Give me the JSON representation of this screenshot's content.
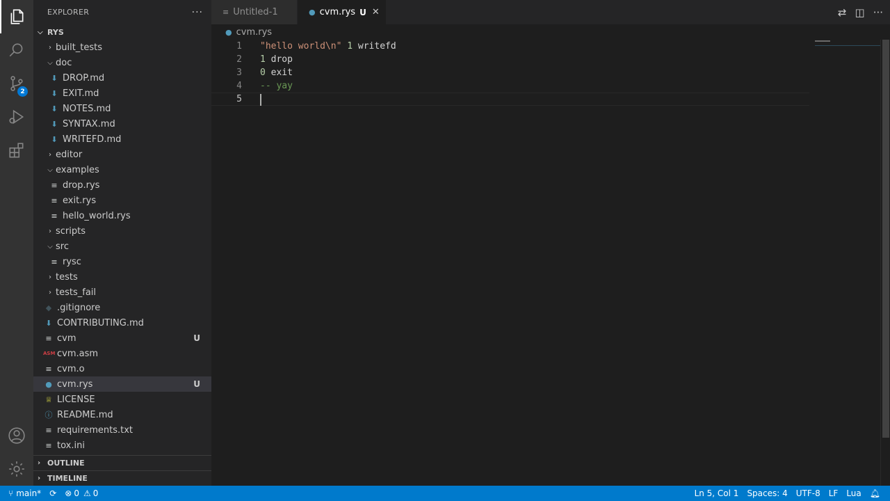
{
  "sidebar": {
    "title": "EXPLORER",
    "more": "···",
    "root": "RYS",
    "items": [
      {
        "label": "built_tests",
        "kind": "folder",
        "open": false,
        "depth": 1
      },
      {
        "label": "doc",
        "kind": "folder",
        "open": true,
        "depth": 1
      },
      {
        "label": "DROP.md",
        "kind": "md",
        "depth": 2
      },
      {
        "label": "EXIT.md",
        "kind": "md",
        "depth": 2
      },
      {
        "label": "NOTES.md",
        "kind": "md",
        "depth": 2
      },
      {
        "label": "SYNTAX.md",
        "kind": "md",
        "depth": 2
      },
      {
        "label": "WRITEFD.md",
        "kind": "md",
        "depth": 2
      },
      {
        "label": "editor",
        "kind": "folder",
        "open": false,
        "depth": 1
      },
      {
        "label": "examples",
        "kind": "folder",
        "open": true,
        "depth": 1
      },
      {
        "label": "drop.rys",
        "kind": "txt",
        "depth": 2
      },
      {
        "label": "exit.rys",
        "kind": "txt",
        "depth": 2
      },
      {
        "label": "hello_world.rys",
        "kind": "txt",
        "depth": 2
      },
      {
        "label": "scripts",
        "kind": "folder",
        "open": false,
        "depth": 1
      },
      {
        "label": "src",
        "kind": "folder",
        "open": true,
        "depth": 1
      },
      {
        "label": "rysc",
        "kind": "txt",
        "depth": 2
      },
      {
        "label": "tests",
        "kind": "folder",
        "open": false,
        "depth": 1
      },
      {
        "label": "tests_fail",
        "kind": "folder",
        "open": false,
        "depth": 1
      },
      {
        "label": ".gitignore",
        "kind": "git",
        "depth": 1
      },
      {
        "label": "CONTRIBUTING.md",
        "kind": "md",
        "depth": 1
      },
      {
        "label": "cvm",
        "kind": "txt",
        "depth": 1,
        "status": "U"
      },
      {
        "label": "cvm.asm",
        "kind": "asm",
        "depth": 1
      },
      {
        "label": "cvm.o",
        "kind": "txt",
        "depth": 1
      },
      {
        "label": "cvm.rys",
        "kind": "rys",
        "depth": 1,
        "status": "U",
        "selected": true
      },
      {
        "label": "LICENSE",
        "kind": "license",
        "depth": 1
      },
      {
        "label": "README.md",
        "kind": "info",
        "depth": 1
      },
      {
        "label": "requirements.txt",
        "kind": "txt",
        "depth": 1
      },
      {
        "label": "tox.ini",
        "kind": "txt",
        "depth": 1
      }
    ],
    "outline": "OUTLINE",
    "timeline": "TIMELINE"
  },
  "activity": {
    "scm_badge": "2"
  },
  "tabs": [
    {
      "label": "Untitled-1",
      "active": false
    },
    {
      "label": "cvm.rys",
      "active": true,
      "modified": "U",
      "close": "✕"
    }
  ],
  "breadcrumb": {
    "file": "cvm.rys"
  },
  "editor": {
    "lines": [
      {
        "num": "1",
        "tokens": [
          {
            "t": "\"hello world\\n\"",
            "c": "str"
          },
          {
            "t": " ",
            "c": ""
          },
          {
            "t": "1",
            "c": "num"
          },
          {
            "t": " writefd",
            "c": ""
          }
        ]
      },
      {
        "num": "2",
        "tokens": [
          {
            "t": "1",
            "c": "num"
          },
          {
            "t": " drop",
            "c": ""
          }
        ]
      },
      {
        "num": "3",
        "tokens": [
          {
            "t": "0",
            "c": "num"
          },
          {
            "t": " exit",
            "c": ""
          }
        ]
      },
      {
        "num": "4",
        "tokens": [
          {
            "t": "-- yay",
            "c": "cmt"
          }
        ]
      },
      {
        "num": "5",
        "tokens": [],
        "current": true
      }
    ]
  },
  "statusbar": {
    "branch": "main*",
    "errors": "0",
    "warnings": "0",
    "position": "Ln 5, Col 1",
    "spaces": "Spaces: 4",
    "encoding": "UTF-8",
    "eol": "LF",
    "language": "Lua"
  },
  "colors": {
    "accent": "#007acc",
    "badge": "#0078d4",
    "selected_row": "#37373d"
  }
}
